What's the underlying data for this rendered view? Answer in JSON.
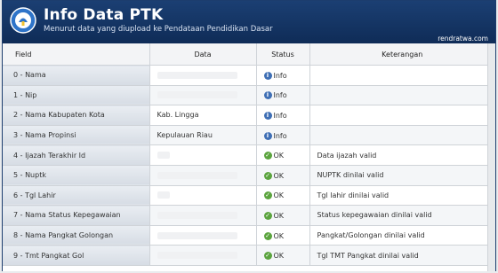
{
  "header": {
    "title": "Info Data PTK",
    "subtitle": "Menurut data yang diupload ke Pendataan Pendidikan Dasar",
    "site": "rendratwa.com"
  },
  "columns": [
    "Field",
    "Data",
    "Status",
    "Keterangan"
  ],
  "rows": [
    {
      "field": "0 - Nama",
      "data": "",
      "status": "Info",
      "status_type": "info",
      "note": ""
    },
    {
      "field": "1 - Nip",
      "data": "",
      "status": "Info",
      "status_type": "info",
      "note": ""
    },
    {
      "field": "2 - Nama Kabupaten Kota",
      "data": "Kab. Lingga",
      "status": "Info",
      "status_type": "info",
      "note": ""
    },
    {
      "field": "3 - Nama Propinsi",
      "data": "Kepulauan Riau",
      "status": "Info",
      "status_type": "info",
      "note": ""
    },
    {
      "field": "4 - Ijazah Terakhir Id",
      "data": "",
      "status": "OK",
      "status_type": "ok",
      "note": "Data ijazah valid"
    },
    {
      "field": "5 - Nuptk",
      "data": "",
      "status": "OK",
      "status_type": "ok",
      "note": "NUPTK dinilai valid"
    },
    {
      "field": "6 - Tgl Lahir",
      "data": "",
      "status": "OK",
      "status_type": "ok",
      "note": "Tgl lahir dinilai valid"
    },
    {
      "field": "7 - Nama Status Kepegawaian",
      "data": "",
      "status": "OK",
      "status_type": "ok",
      "note": "Status kepegawaian dinilai valid"
    },
    {
      "field": "8 - Nama Pangkat Golongan",
      "data": "",
      "status": "OK",
      "status_type": "ok",
      "note": "Pangkat/Golongan dinilai valid"
    },
    {
      "field": "9 - Tmt Pangkat Gol",
      "data": "",
      "status": "OK",
      "status_type": "ok",
      "note": "Tgl TMT Pangkat dinilai valid"
    }
  ],
  "colors": {
    "header_bg": "#12315f",
    "info_icon": "#3f6fb5",
    "ok_icon": "#5ba43e"
  }
}
